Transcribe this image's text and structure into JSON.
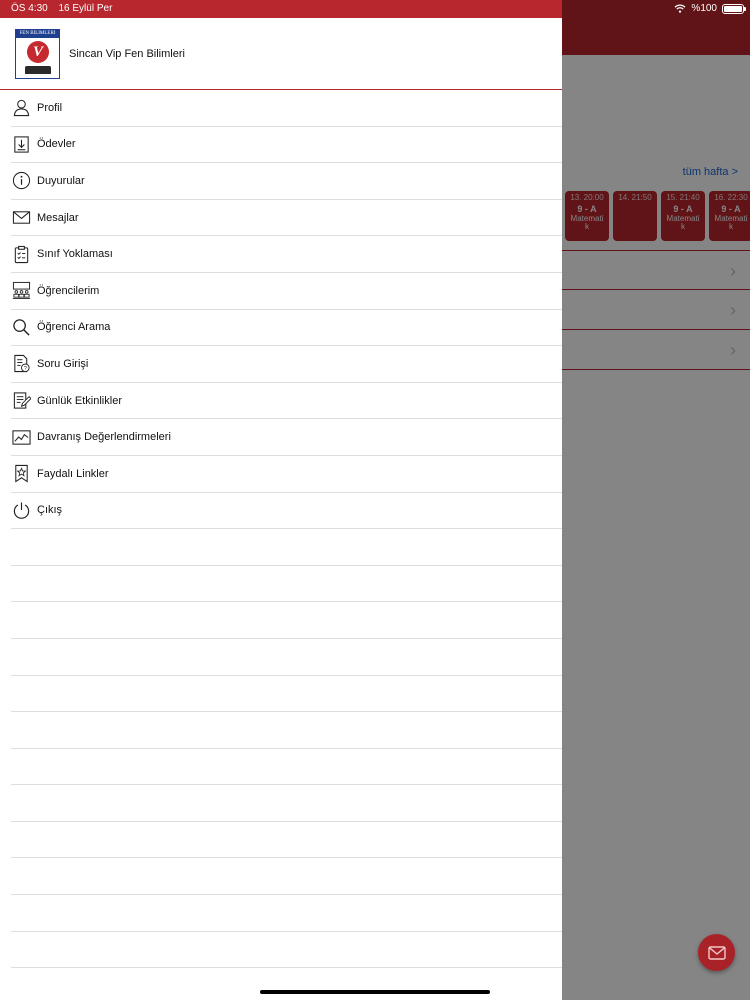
{
  "status_bar": {
    "time": "ÖS 4:30",
    "date": "16 Eylül Per",
    "battery_label": "%100",
    "wifi_icon": "wifi-icon",
    "battery_icon": "battery-icon"
  },
  "drawer": {
    "school_name": "Sincan Vip Fen Bilimleri",
    "logo_text": "FEN BİLİMLERİ",
    "logo_letter": "V",
    "menu_items": [
      {
        "label": "Profil",
        "icon": "person-icon"
      },
      {
        "label": "Ödevler",
        "icon": "download-document-icon"
      },
      {
        "label": "Duyurular",
        "icon": "info-icon"
      },
      {
        "label": "Mesajlar",
        "icon": "envelope-icon"
      },
      {
        "label": "Sınıf Yoklaması",
        "icon": "clipboard-icon"
      },
      {
        "label": "Öğrencilerim",
        "icon": "classroom-icon"
      },
      {
        "label": "Öğrenci Arama",
        "icon": "search-icon"
      },
      {
        "label": "Soru Girişi",
        "icon": "question-document-icon"
      },
      {
        "label": "Günlük Etkinlikler",
        "icon": "edit-document-icon"
      },
      {
        "label": "Davranış Değerlendirmeleri",
        "icon": "chart-icon"
      },
      {
        "label": "Faydalı Linkler",
        "icon": "star-bookmark-icon"
      },
      {
        "label": "Çıkış",
        "icon": "power-icon"
      }
    ]
  },
  "background": {
    "week_link": "tüm hafta >",
    "lessons": [
      {
        "time": "13. 20:00",
        "class": "9 - A",
        "subject": "Matematik"
      },
      {
        "time": "14. 21:50",
        "class": "",
        "subject": ""
      },
      {
        "time": "15. 21:40",
        "class": "9 - A",
        "subject": "Matematik"
      },
      {
        "time": "16. 22:30",
        "class": "9 - A",
        "subject": "Matematik"
      }
    ]
  },
  "colors": {
    "brand_red": "#b8272d",
    "link_blue": "#1a66d6"
  }
}
